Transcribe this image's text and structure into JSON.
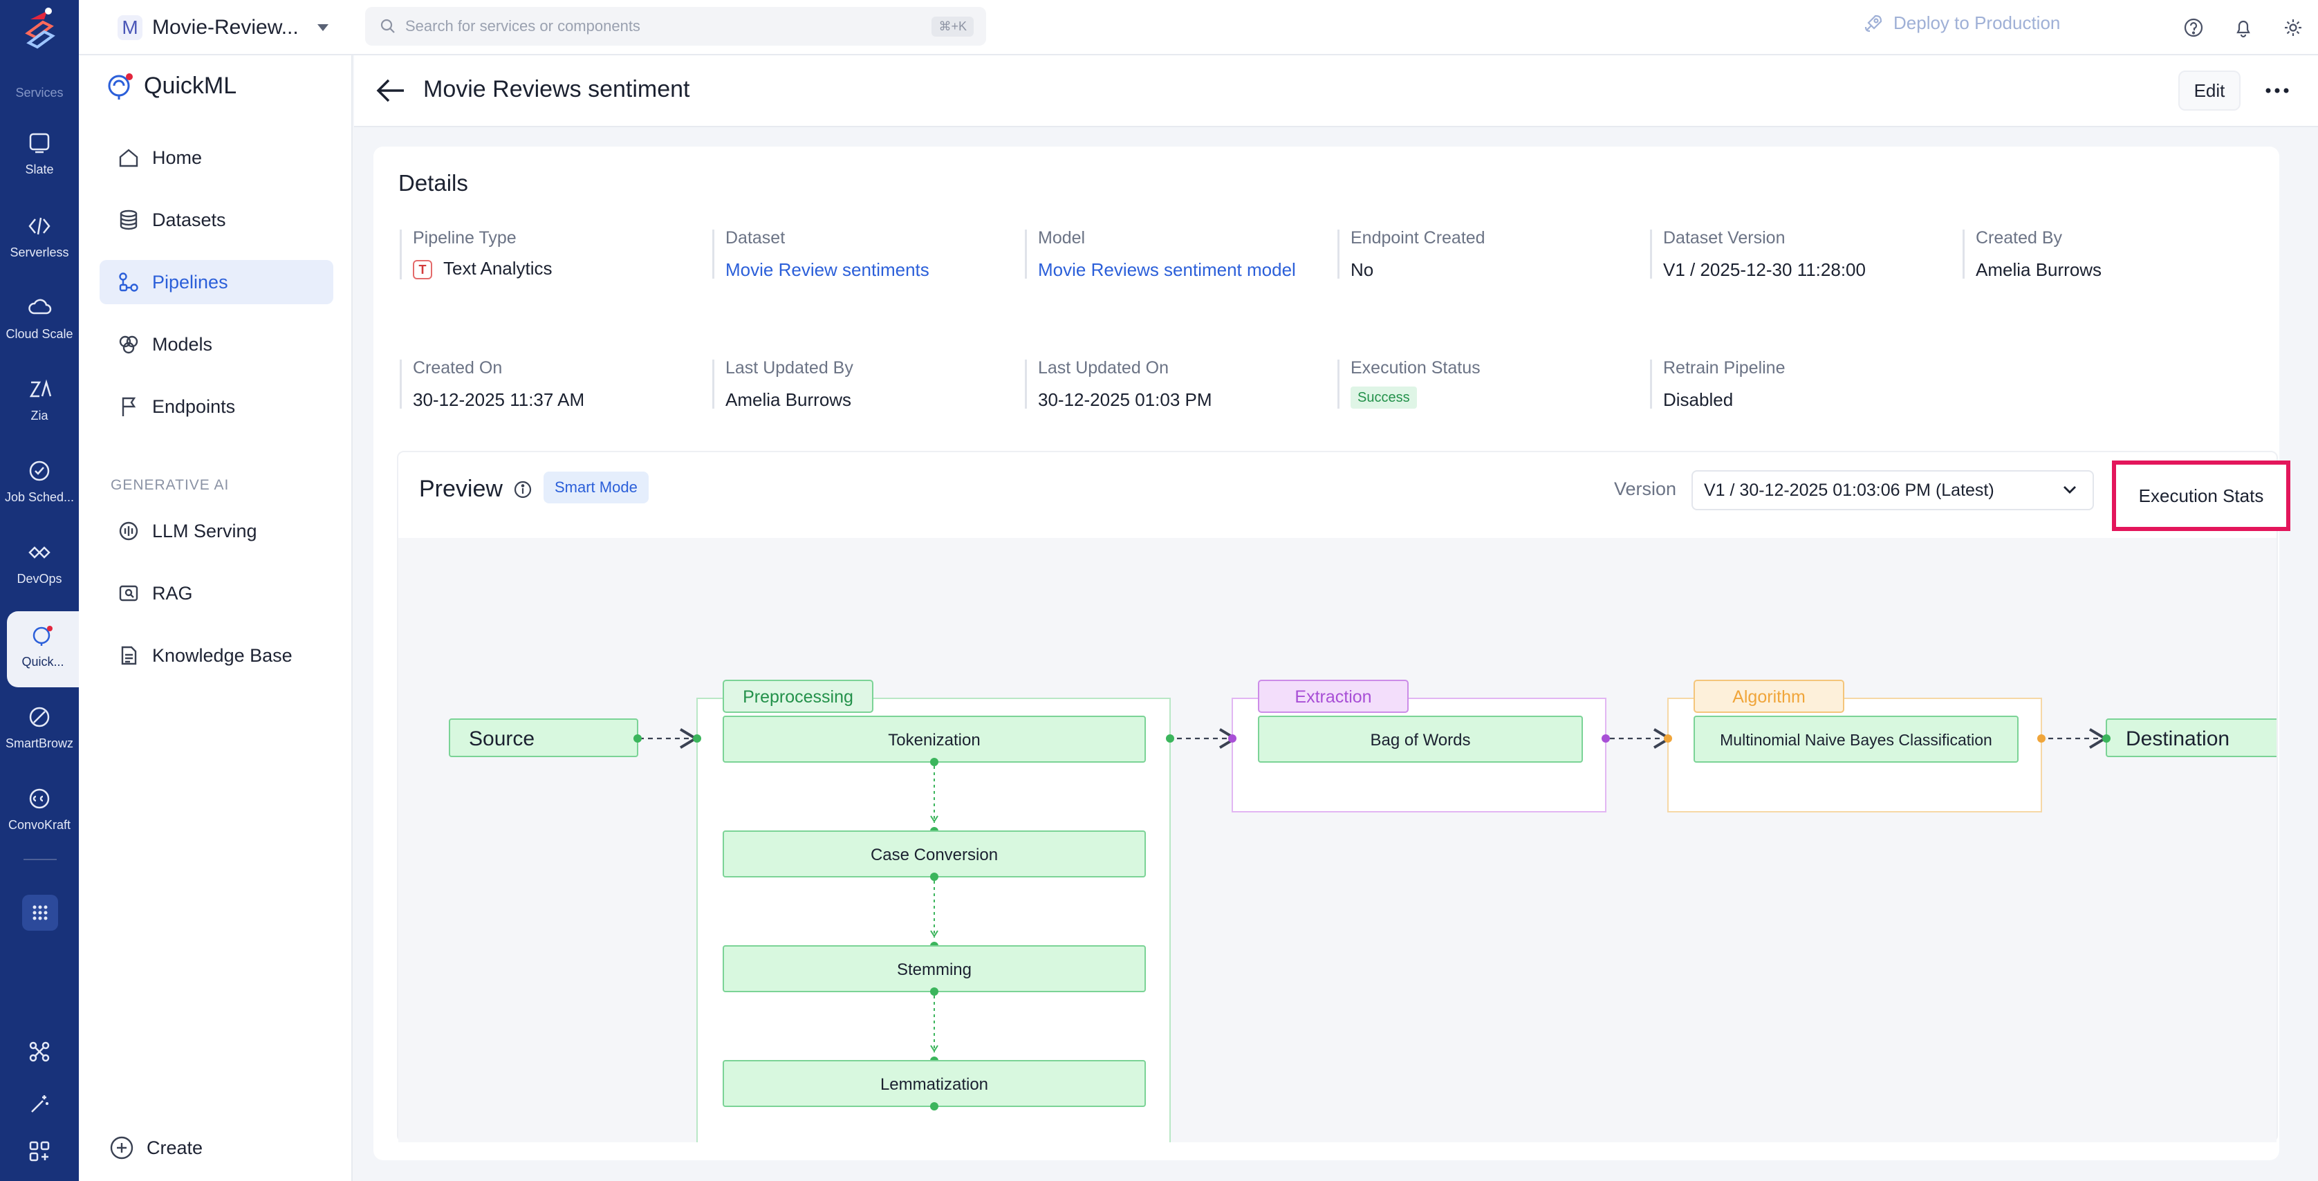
{
  "rail": {
    "services_label": "Services",
    "items": [
      {
        "label": "Slate",
        "icon": "slate-icon"
      },
      {
        "label": "Serverless",
        "icon": "serverless-icon"
      },
      {
        "label": "Cloud Scale",
        "icon": "cloud-scale-icon"
      },
      {
        "label": "Zia",
        "icon": "zia-icon"
      },
      {
        "label": "Job Sched...",
        "icon": "job-scheduler-icon"
      },
      {
        "label": "DevOps",
        "icon": "devops-icon"
      },
      {
        "label": "Quick...",
        "icon": "quickml-icon"
      },
      {
        "label": "SmartBrowz",
        "icon": "smartbrowz-icon"
      },
      {
        "label": "ConvoKraft",
        "icon": "convokraft-icon"
      }
    ]
  },
  "topbar": {
    "project_initial": "M",
    "project_name": "Movie-Review...",
    "search_placeholder": "Search for services or components",
    "search_shortcut": "⌘+K",
    "deploy_label": "Deploy to Production"
  },
  "sidenav": {
    "brand": "QuickML",
    "items": [
      {
        "label": "Home",
        "icon": "home-icon"
      },
      {
        "label": "Datasets",
        "icon": "datasets-icon"
      },
      {
        "label": "Pipelines",
        "icon": "pipelines-icon",
        "active": true
      },
      {
        "label": "Models",
        "icon": "models-icon"
      },
      {
        "label": "Endpoints",
        "icon": "endpoints-icon"
      }
    ],
    "section_label": "GENERATIVE AI",
    "gen_items": [
      {
        "label": "LLM Serving",
        "icon": "llm-serving-icon"
      },
      {
        "label": "RAG",
        "icon": "rag-icon"
      },
      {
        "label": "Knowledge Base",
        "icon": "knowledge-base-icon"
      }
    ],
    "create_label": "Create"
  },
  "header": {
    "title": "Movie Reviews sentiment",
    "edit_label": "Edit"
  },
  "details": {
    "heading": "Details",
    "fields": [
      {
        "key": "Pipeline Type",
        "value": "Text Analytics",
        "icon_letter": "T"
      },
      {
        "key": "Dataset",
        "value": "Movie Review sentiments",
        "link": true
      },
      {
        "key": "Model",
        "value": "Movie Reviews sentiment model",
        "link": true
      },
      {
        "key": "Endpoint Created",
        "value": "No"
      },
      {
        "key": "Dataset Version",
        "value": "V1 / 2025-12-30 11:28:00"
      },
      {
        "key": "Created By",
        "value": "Amelia Burrows"
      },
      {
        "key": "Created On",
        "value": "30-12-2025 11:37 AM"
      },
      {
        "key": "Last Updated By",
        "value": "Amelia Burrows"
      },
      {
        "key": "Last Updated On",
        "value": "30-12-2025 01:03 PM"
      },
      {
        "key": "Execution Status",
        "value": "Success",
        "badge": true
      },
      {
        "key": "Retrain Pipeline",
        "value": "Disabled"
      }
    ]
  },
  "preview": {
    "heading": "Preview",
    "mode_badge": "Smart Mode",
    "version_label": "Version",
    "version_value": "V1 / 30-12-2025 01:03:06 PM (Latest)",
    "exec_stats_label": "Execution Stats",
    "pipeline": {
      "source": "Source",
      "destination": "Destination",
      "stages": [
        {
          "name": "Preprocessing",
          "steps": [
            "Tokenization",
            "Case Conversion",
            "Stemming",
            "Lemmatization"
          ],
          "color": "#3bb55c"
        },
        {
          "name": "Extraction",
          "steps": [
            "Bag of Words"
          ],
          "color": "#a84fd6"
        },
        {
          "name": "Algorithm",
          "steps": [
            "Multinomial Naive Bayes Classification"
          ],
          "color": "#f0a53a"
        }
      ]
    }
  },
  "colors": {
    "rail_bg": "#18327a",
    "accent": "#2b5fd9",
    "highlight": "#e3165b",
    "success": "#23914a"
  }
}
